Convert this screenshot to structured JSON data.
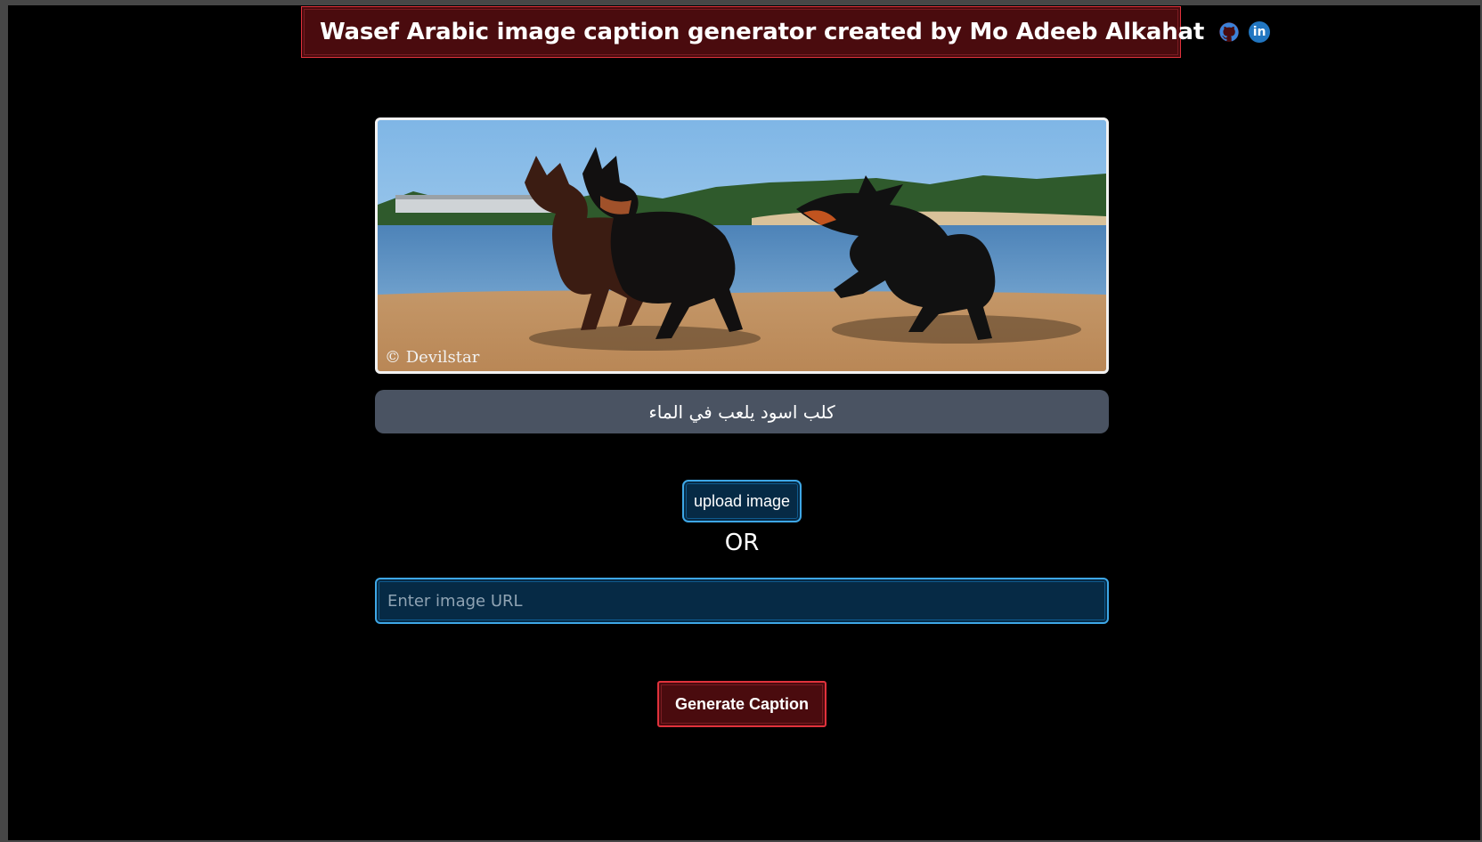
{
  "header": {
    "title": "Wasef Arabic image caption generator created by Mo Adeeb Alkahat",
    "github_icon": "github-icon",
    "linkedin_icon": "linkedin-icon",
    "linkedin_text": "in"
  },
  "preview": {
    "watermark": "© Devilstar"
  },
  "caption": {
    "text": "كلب اسود يلعب في الماء"
  },
  "upload": {
    "label": "upload image"
  },
  "separator": {
    "text": "OR"
  },
  "url_input": {
    "placeholder": "Enter image URL",
    "value": ""
  },
  "generate": {
    "label": "Generate Caption"
  },
  "colors": {
    "header_bg": "#4a0b0e",
    "header_border": "#e0323c",
    "caption_bg": "#4a5362",
    "input_bg": "#062a45",
    "input_border": "#3ea7e6"
  }
}
